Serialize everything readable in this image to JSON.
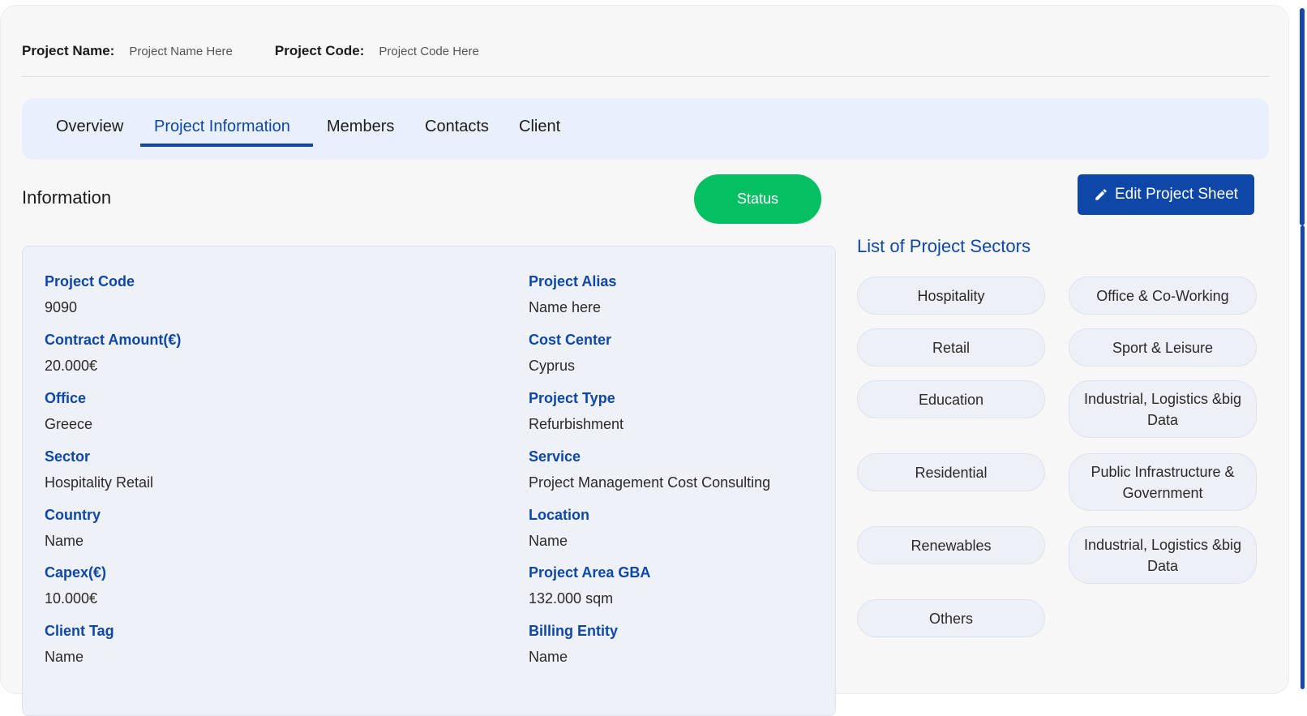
{
  "header": {
    "project_name_label": "Project Name:",
    "project_name_value": "Project Name Here",
    "project_code_label": "Project Code:",
    "project_code_value": "Project Code Here"
  },
  "tabs": [
    {
      "label": "Overview",
      "active": false
    },
    {
      "label": "Project Information",
      "active": true
    },
    {
      "label": "Members",
      "active": false
    },
    {
      "label": "Contacts",
      "active": false
    },
    {
      "label": "Client",
      "active": false
    }
  ],
  "information": {
    "title": "Information",
    "status_label": "Status",
    "fields_left": [
      {
        "label": "Project Code",
        "value": "9090"
      },
      {
        "label": "Contract Amount(€)",
        "value": "20.000€"
      },
      {
        "label": "Office",
        "value": "Greece"
      },
      {
        "label": "Sector",
        "value": "Hospitality Retail"
      },
      {
        "label": "Country",
        "value": "Name"
      },
      {
        "label": "Capex(€)",
        "value": "10.000€"
      },
      {
        "label": "Client Tag",
        "value": "Name"
      }
    ],
    "fields_right": [
      {
        "label": "Project Alias",
        "value": "Name here"
      },
      {
        "label": "Cost Center",
        "value": "Cyprus"
      },
      {
        "label": "Project Type",
        "value": "Refurbishment"
      },
      {
        "label": "Service",
        "value": "Project Management Cost Consulting"
      },
      {
        "label": "Location",
        "value": "Name"
      },
      {
        "label": "Project Area GBA",
        "value": "132.000 sqm"
      },
      {
        "label": "Billing Entity",
        "value": "Name"
      }
    ]
  },
  "actions": {
    "edit_label": "Edit Project Sheet",
    "edit_icon": "pencil-icon"
  },
  "sectors": {
    "title": "List of Project Sectors",
    "left": [
      "Hospitality",
      "Retail",
      "Education",
      "Residential",
      "Renewables",
      "Others"
    ],
    "right": [
      "Office & Co-Working",
      "Sport & Leisure",
      "Industrial, Logistics &big Data",
      "Public Infrastructure & Government",
      "Industrial, Logistics &big Data"
    ]
  },
  "colors": {
    "accent": "#0e47a8",
    "status": "#05c062",
    "tab_bar": "#eaf0fb",
    "panel": "#eef1f7"
  }
}
